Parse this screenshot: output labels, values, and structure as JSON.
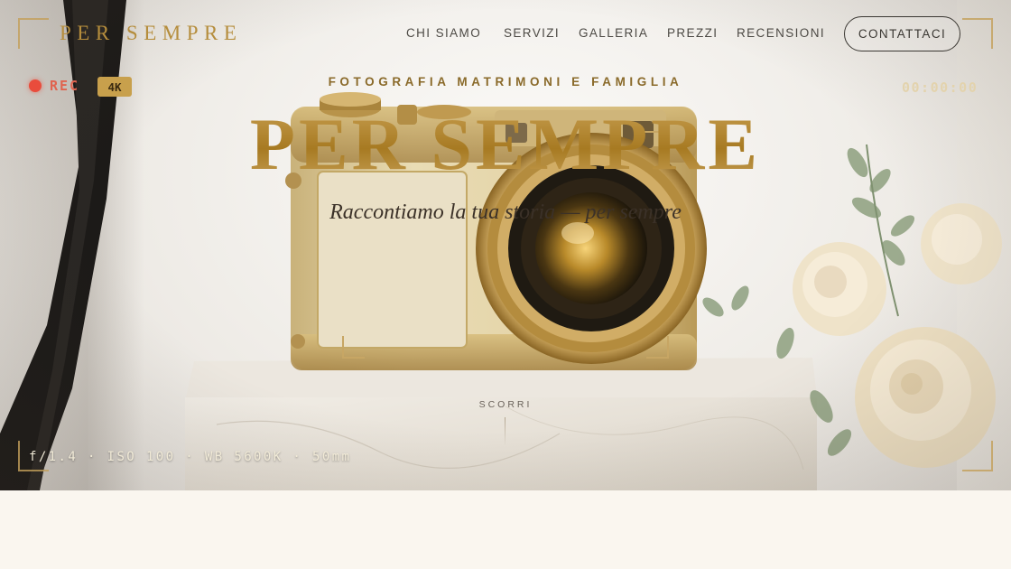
{
  "brand": {
    "logo": "PER SEMPRE"
  },
  "nav": {
    "items": [
      {
        "label": "CHI SIAMO"
      },
      {
        "label": "SERVIZI"
      },
      {
        "label": "GALLERIA"
      },
      {
        "label": "PREZZI"
      },
      {
        "label": "RECENSIONI"
      }
    ],
    "cta_label": "CONTATTACI"
  },
  "hero": {
    "eyebrow": "FOTOGRAFIA MATRIMONI E FAMIGLIA",
    "title": "PER SEMPRE",
    "tagline": "Raccontiamo la tua storia — per sempre",
    "scroll_label": "SCORRI"
  },
  "viewfinder": {
    "rec_label": "REC",
    "resolution_badge": "4K",
    "timecode": "00:00:00",
    "exif": "f/1.4 · ISO 100 · WB 5600K · 50mm"
  },
  "colors": {
    "gold": "#b88a2e",
    "rec_red": "#e94c3c",
    "page_bg": "#faf6ef"
  },
  "icons": [
    "rec-dot-icon",
    "camera-illustration",
    "rose-bouquet-illustration"
  ]
}
